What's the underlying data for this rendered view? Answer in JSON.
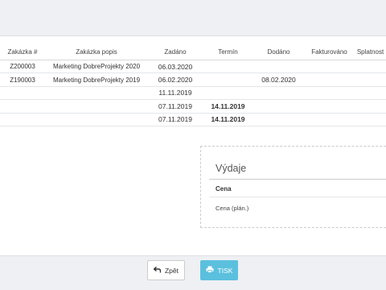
{
  "table": {
    "headers": [
      "Zakázka #",
      "Zakázka popis",
      "Zadáno",
      "Termín",
      "Dodáno",
      "Fakturováno",
      "Splatnost"
    ],
    "rows": [
      {
        "zakazka": "Z200003",
        "popis": "Marketing DobreProjekty 2020",
        "zadano": "06.03.2020",
        "termin": "",
        "dodano": "",
        "fakturovano": "",
        "splatnost": ""
      },
      {
        "zakazka": "Z190003",
        "popis": "Marketing DobreProjekty 2019",
        "zadano": "06.02.2020",
        "termin": "",
        "dodano": "08.02.2020",
        "fakturovano": "",
        "splatnost": ""
      },
      {
        "zakazka": "",
        "popis": "",
        "zadano": "11.11.2019",
        "termin": "",
        "dodano": "",
        "fakturovano": "",
        "splatnost": ""
      },
      {
        "zakazka": "",
        "popis": "",
        "zadano": "07.11.2019",
        "termin": "14.11.2019",
        "dodano": "",
        "fakturovano": "",
        "splatnost": ""
      },
      {
        "zakazka": "",
        "popis": "",
        "zadano": "07.11.2019",
        "termin": "14.11.2019",
        "dodano": "",
        "fakturovano": "",
        "splatnost": ""
      }
    ]
  },
  "vydaje": {
    "title": "Výdaje",
    "cena_label": "Cena",
    "cena_plan_label": "Cena (plán.)"
  },
  "buttons": {
    "back_label": "Zpět",
    "back_icon": "back-arrow-icon",
    "print_label": "TISK",
    "print_icon": "printer-icon"
  },
  "colors": {
    "print_button": "#5bc0de",
    "background": "#eef0f3"
  }
}
